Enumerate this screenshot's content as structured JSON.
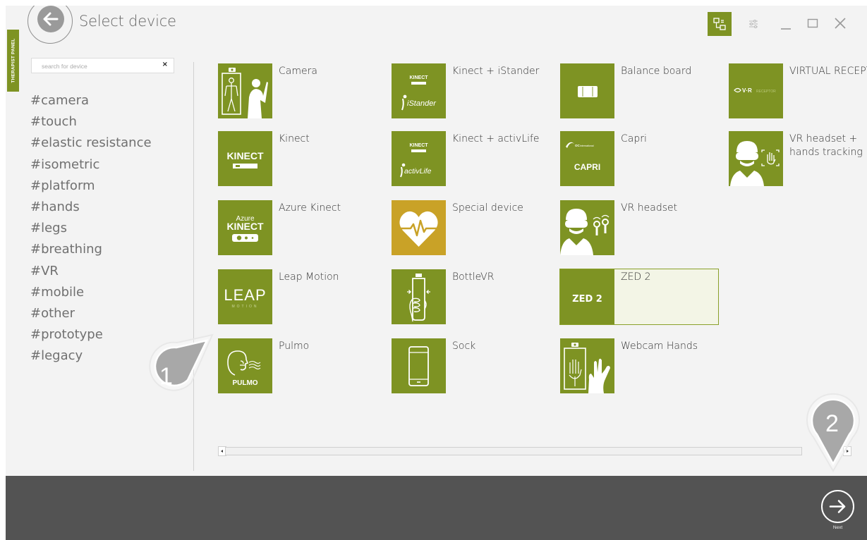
{
  "window": {
    "title": "Select device"
  },
  "sidebar": {
    "therapist_tab": "THERAPIST PANEL",
    "search_placeholder": "search for device",
    "search_clear": "×",
    "tags": [
      "#camera",
      "#touch",
      "#elastic resistance",
      "#isometric",
      "#platform",
      "#hands",
      "#legs",
      "#breathing",
      "#VR",
      "#mobile",
      "#other",
      "#prototype",
      "#legacy"
    ]
  },
  "devices": [
    {
      "label": "Camera",
      "icon": "camera-person-icon"
    },
    {
      "label": "Kinect + iStander",
      "icon": "kinect-istander-logo",
      "tile_text": [
        "KINECT",
        "iStander"
      ]
    },
    {
      "label": "Balance board",
      "icon": "balance-board-icon"
    },
    {
      "label": "VIRTUAL RECEPTOR",
      "icon": "virtual-receptor-logo",
      "tile_text": [
        "V·R",
        "RECEPTOR"
      ]
    },
    {
      "label": "Kinect",
      "icon": "kinect-logo",
      "tile_text": [
        "KINECT"
      ]
    },
    {
      "label": "Kinect + activLife",
      "icon": "kinect-activlife-logo",
      "tile_text": [
        "KINECT",
        "activLife"
      ]
    },
    {
      "label": "Capri",
      "icon": "capri-logo",
      "tile_text": [
        "CAPRI",
        "OC",
        "international"
      ]
    },
    {
      "label": "VR headset + hands tracking",
      "icon": "vr-hands-icon"
    },
    {
      "label": "Azure Kinect",
      "icon": "azure-kinect-logo",
      "tile_text": [
        "Azure",
        "KINECT"
      ]
    },
    {
      "label": "Special device",
      "icon": "heart-pulse-icon",
      "color": "#c9a227"
    },
    {
      "label": "VR headset",
      "icon": "vr-headset-icon"
    },
    {
      "label": "Leap Motion",
      "icon": "leap-motion-logo",
      "tile_text": [
        "LEAP",
        "MOTION"
      ]
    },
    {
      "label": "BottleVR",
      "icon": "bottle-hand-icon"
    },
    {
      "label": "ZED 2",
      "icon": "zed2-logo",
      "tile_text": [
        "ZED 2"
      ],
      "selected": true
    },
    {
      "label": "Pulmo",
      "icon": "pulmo-breath-icon",
      "tile_text": [
        "PULMO"
      ]
    },
    {
      "label": "Sock",
      "icon": "smartphone-icon"
    },
    {
      "label": "Webcam Hands",
      "icon": "webcam-hand-icon"
    }
  ],
  "footer": {
    "next_label": "Next"
  },
  "guide_pins": [
    {
      "number": "1"
    },
    {
      "number": "2"
    }
  ],
  "colors": {
    "accent": "#7e9323",
    "special": "#c9a227",
    "footer": "#535353",
    "background": "#f3f3f3"
  }
}
